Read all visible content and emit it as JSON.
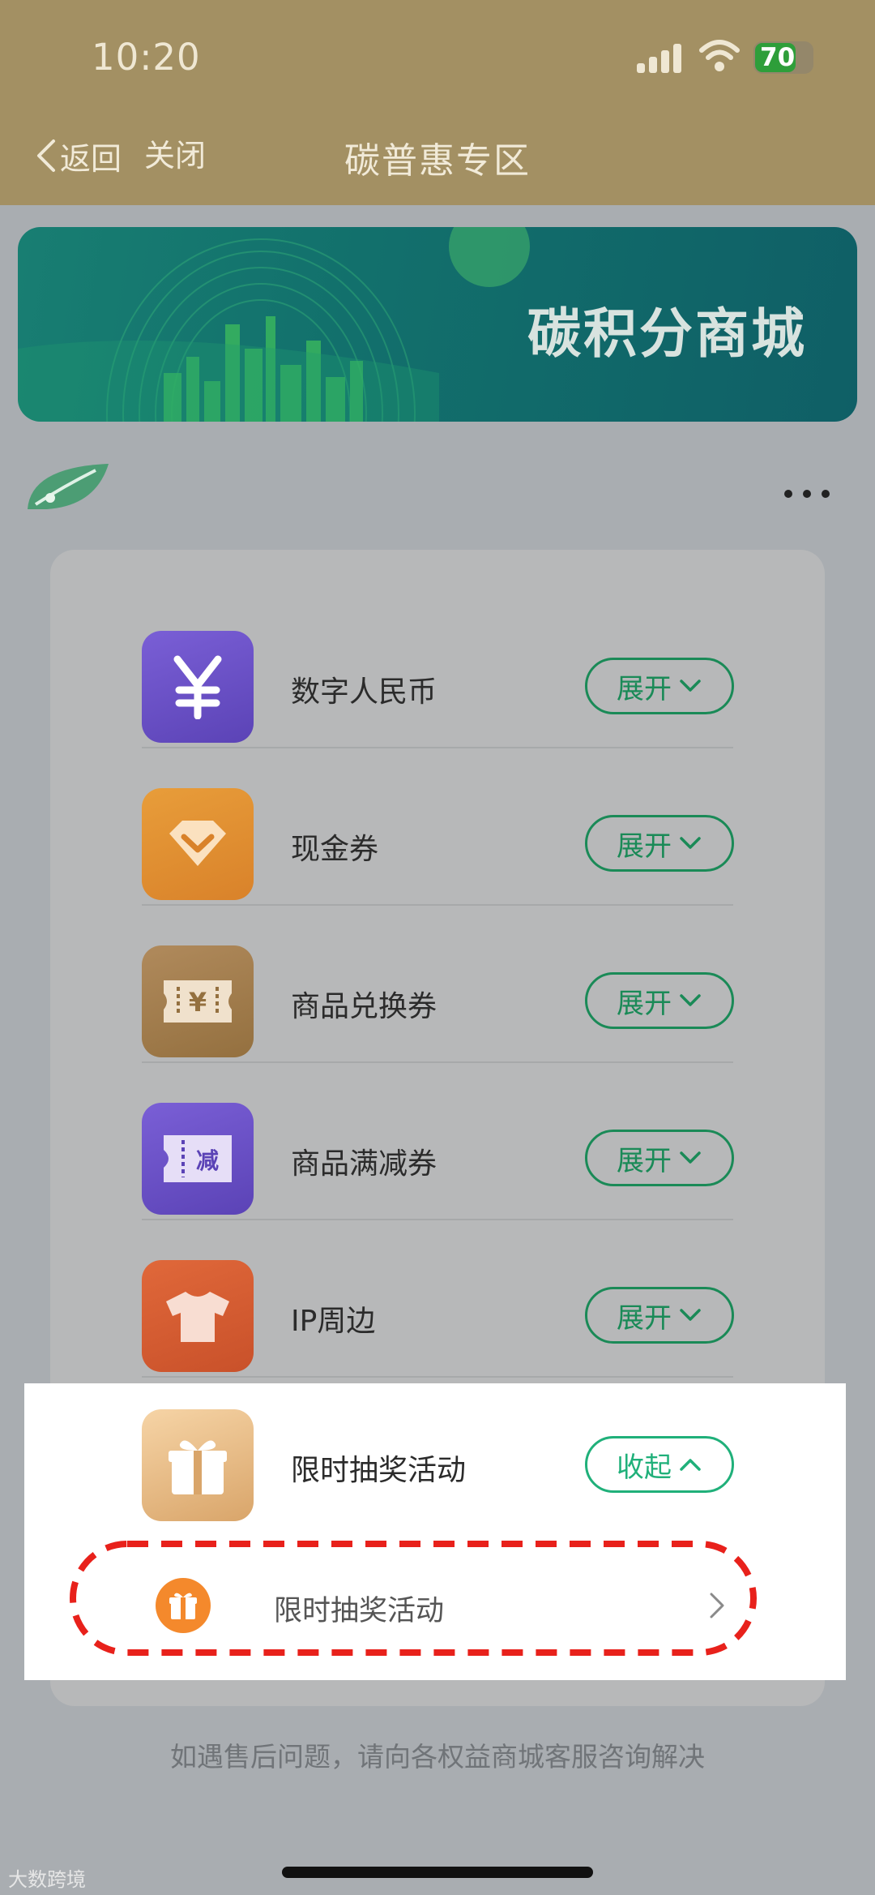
{
  "status_bar": {
    "time": "10:20",
    "battery": "70",
    "icons": [
      "signal-icon",
      "wifi-icon",
      "battery-icon"
    ]
  },
  "nav": {
    "back_label": "返回",
    "close_label": "关闭",
    "title": "碳普惠专区"
  },
  "banner": {
    "title": "碳积分商城"
  },
  "items": [
    {
      "label": "数字人民币",
      "button": "展开",
      "icon": "yuan-icon",
      "color": "#6b52c6"
    },
    {
      "label": "现金券",
      "button": "展开",
      "icon": "diamond-coupon-icon",
      "color": "#e1902f"
    },
    {
      "label": "商品兑换券",
      "button": "展开",
      "icon": "ticket-icon",
      "color": "#a37a4a"
    },
    {
      "label": "商品满减券",
      "button": "展开",
      "icon": "discount-coupon-icon",
      "color": "#6b52c6"
    },
    {
      "label": "IP周边",
      "button": "展开",
      "icon": "tshirt-icon",
      "color": "#d8592a"
    },
    {
      "label": "限时抽奖活动",
      "button": "收起",
      "icon": "gift-icon",
      "color": "#e9b47a"
    }
  ],
  "expanded_item": {
    "label": "限时抽奖活动",
    "icon": "gift-icon"
  },
  "discount_badge": "减",
  "footer_note": "如遇售后问题，请向各权益商城客服咨询解决",
  "watermark": "大数跨境"
}
